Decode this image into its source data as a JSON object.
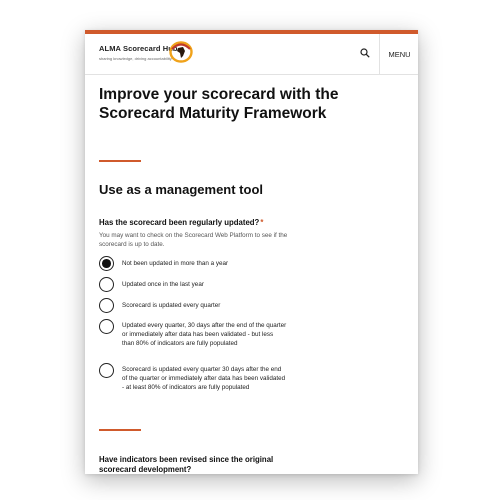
{
  "header": {
    "logo_title": "ALMA Scorecard Hub",
    "logo_tagline": "sharing knowledge, driving accountability",
    "menu_label": "MENU"
  },
  "page": {
    "title": "Improve your scorecard with the Scorecard Maturity Framework",
    "section_title": "Use as a management tool"
  },
  "question1": {
    "label": "Has the scorecard been regularly updated?",
    "required_mark": "*",
    "hint": "You may want to check on the Scorecard Web Platform to see if the scorecard is up to date.",
    "options": [
      {
        "label": "Not been updated in more than a year",
        "selected": true
      },
      {
        "label": "Updated once in the last year",
        "selected": false
      },
      {
        "label": "Scorecard is updated every quarter",
        "selected": false
      },
      {
        "label": "Updated every quarter, 30 days after the end of the quarter or immediately after data has been validated - but less than 80% of indicators are fully populated",
        "selected": false
      },
      {
        "label": "Scorecard is updated every quarter 30 days after the end of the quarter or immediately after data has been validated - at least 80% of indicators are fully populated",
        "selected": false
      }
    ]
  },
  "question2": {
    "label": "Have indicators been revised since the original scorecard development?"
  },
  "colors": {
    "accent": "#d05a2c",
    "logo_orange": "#f0a21a",
    "logo_dark": "#c0392b",
    "text": "#111111"
  }
}
